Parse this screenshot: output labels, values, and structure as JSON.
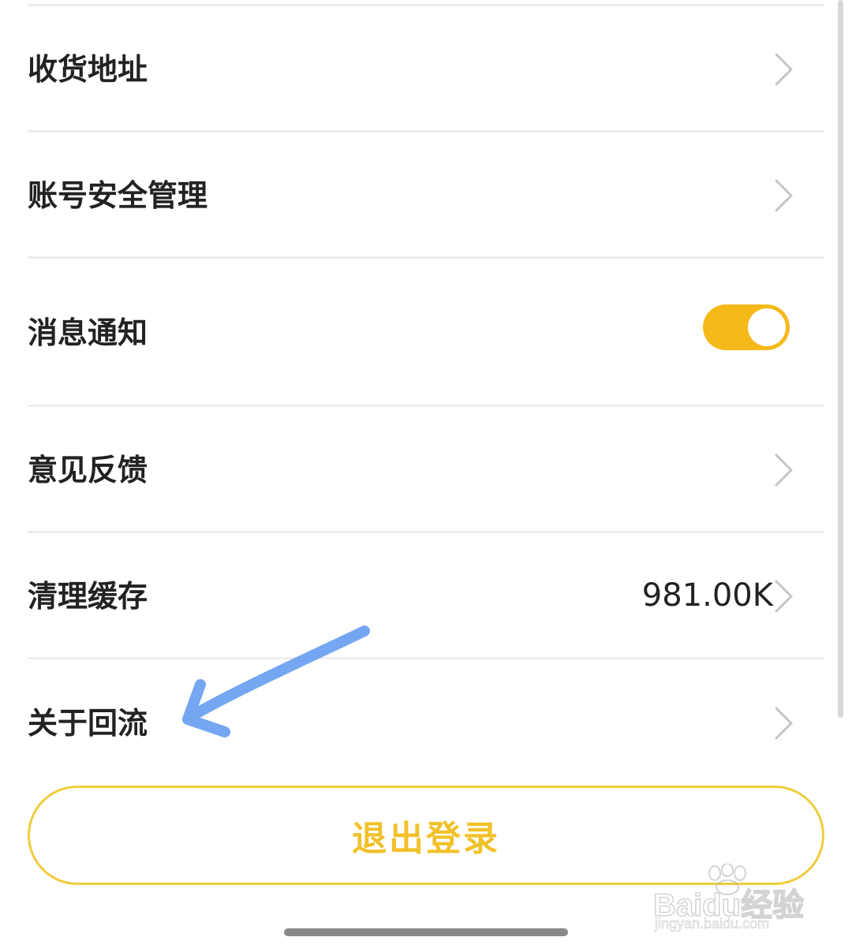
{
  "settings": {
    "items": [
      {
        "label": "收货地址"
      },
      {
        "label": "账号安全管理"
      },
      {
        "label": "消息通知",
        "toggle_on": true
      },
      {
        "label": "意见反馈"
      },
      {
        "label": "清理缓存",
        "value": "981.00K"
      },
      {
        "label": "关于回流"
      }
    ],
    "logout_label": "退出登录"
  },
  "colors": {
    "accent": "#f5b91a",
    "logout_border": "#f0cc3c",
    "logout_text": "#f1c12a",
    "annotation_arrow": "#74a6f2"
  },
  "icons": {
    "row_arrow": "chevron-right-icon",
    "annotation": "arrow-annotation-icon"
  },
  "watermark": {
    "brand": "Baidu经验",
    "url": "jingyan.baidu.com"
  }
}
